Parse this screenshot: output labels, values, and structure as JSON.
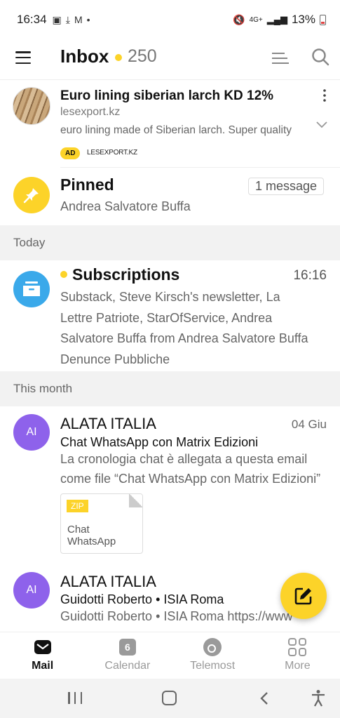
{
  "status_bar": {
    "time": "16:34",
    "battery": "13%",
    "network": "4G+"
  },
  "header": {
    "title": "Inbox",
    "unread_count": "250"
  },
  "ad": {
    "title": "Euro lining siberian larch KD 12%",
    "domain": "lesexport.kz",
    "snippet": "euro lining made of Siberian larch. Super quality",
    "badge": "AD",
    "source": "LESEXPORT.KZ"
  },
  "pinned": {
    "title": "Pinned",
    "count": "1 message",
    "from": "Andrea Salvatore Buffa"
  },
  "sections": {
    "today": "Today",
    "this_month": "This month"
  },
  "subscriptions": {
    "title": "Subscriptions",
    "time": "16:16",
    "body": "Substack, Steve Kirsch's newsletter, La Lettre Patriote, StarOfService, Andrea Salvatore Buffa from Andrea Salvatore Buffa Denunce Pubbliche"
  },
  "mails": [
    {
      "initials": "AI",
      "sender": "ALATA ITALIA",
      "date": "04 Giu",
      "subject": "Chat WhatsApp con Matrix Edizioni",
      "snippet": "La cronologia chat è allegata a questa email come file “Chat WhatsApp con Matrix Edizioni”",
      "attachment": {
        "type": "ZIP",
        "name": "Chat WhatsApp"
      }
    },
    {
      "initials": "AI",
      "sender": "ALATA ITALIA",
      "date": "",
      "subject": "Guidotti Roberto • ISIA Roma",
      "snippet": "Guidotti Roberto • ISIA Roma https://www"
    }
  ],
  "tabs": [
    {
      "label": "Mail",
      "icon": "mail-icon",
      "active": true
    },
    {
      "label": "Calendar",
      "icon": "calendar-icon",
      "badge": "6"
    },
    {
      "label": "Telemost",
      "icon": "telemost-icon"
    },
    {
      "label": "More",
      "icon": "more-grid-icon"
    }
  ],
  "colors": {
    "accent_yellow": "#fcd329",
    "avatar_purple": "#8e62eb",
    "subscriptions_blue": "#3aa9ea"
  }
}
